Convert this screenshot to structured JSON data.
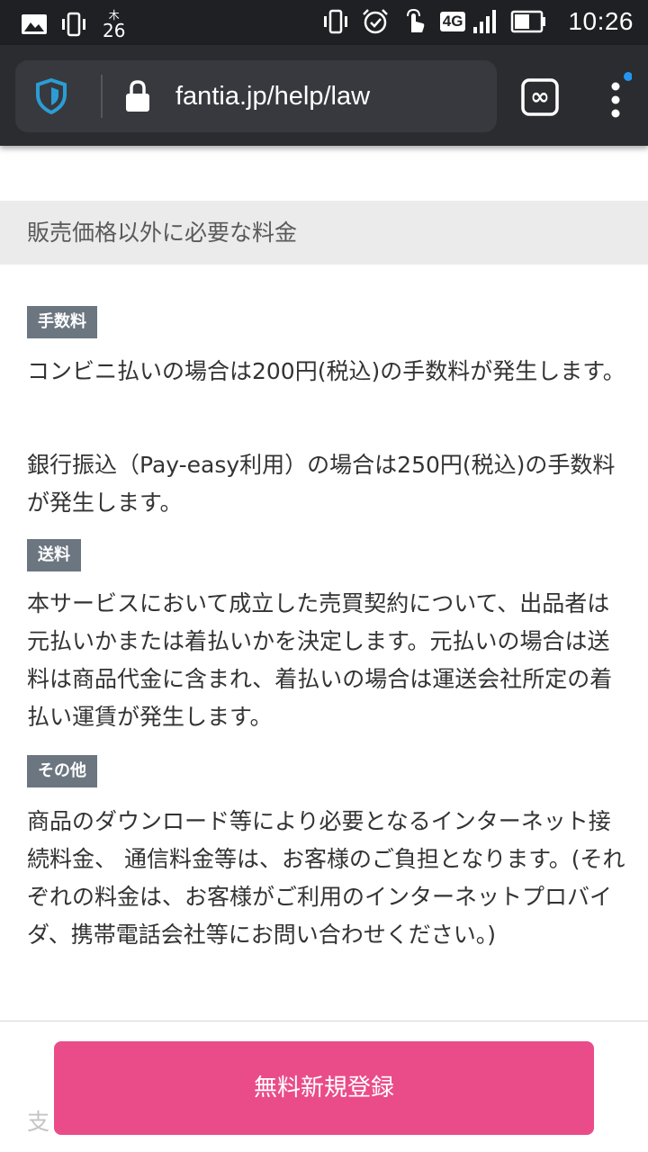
{
  "status_bar": {
    "date_top": "木",
    "date_bottom": "26",
    "network": "4G",
    "time": "10:26",
    "icons_left": [
      "image-icon",
      "vibrate-icon"
    ],
    "icons_right": [
      "vibrate-icon",
      "alarm-icon",
      "touch-icon",
      "signal-icon",
      "battery-icon"
    ]
  },
  "browser": {
    "url": "fantia.jp/help/law",
    "tab_count": "∞",
    "shield_color": "#2b9dd6",
    "notification_dot_color": "#2196f3"
  },
  "section": {
    "title": "販売価格以外に必要な料金"
  },
  "fees": {
    "tag_label": "手数料",
    "para1": "コンビニ払いの場合は200円(税込)の手数料が発生します。",
    "para2": "銀行振込（Pay-easy利用）の場合は250円(税込)の手数料が発生します。"
  },
  "shipping": {
    "tag_label": "送料",
    "para": "本サービスにおいて成立した売買契約について、出品者は元払いかまたは着払いかを決定します。元払いの場合は送料は商品代金に含まれ、着払いの場合は運送会社所定の着払い運賃が発生します。"
  },
  "other": {
    "tag_label": "その他",
    "para": "商品のダウンロード等により必要となるインターネット接続料金、 通信料金等は、お客様のご負担となります。(それぞれの料金は、お客様がご利用のインターネットプロバイダ、携帯電話会社等にお問い合わせください。)"
  },
  "cta": {
    "label": "無料新規登録",
    "color": "#ea4c89"
  },
  "next_section_partial": "支"
}
